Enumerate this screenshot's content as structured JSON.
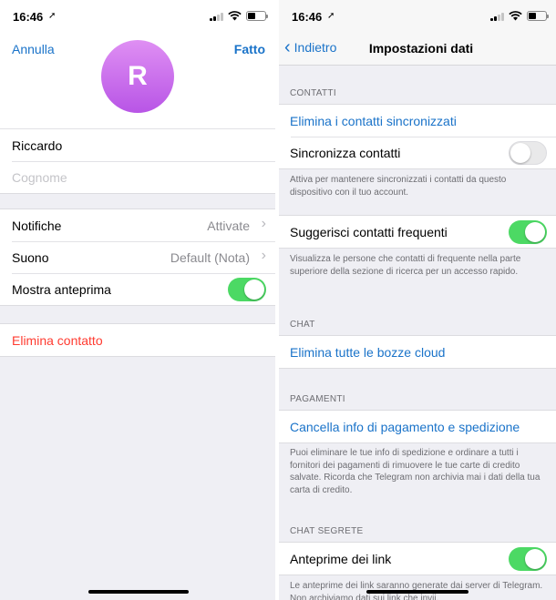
{
  "left": {
    "status": {
      "time": "16:46"
    },
    "nav": {
      "cancel": "Annulla",
      "done": "Fatto"
    },
    "avatar": {
      "initial": "R"
    },
    "name": {
      "first": "Riccardo",
      "last_placeholder": "Cognome"
    },
    "settings": [
      {
        "label": "Notifiche",
        "value": "Attivate"
      },
      {
        "label": "Suono",
        "value": "Default (Nota)"
      },
      {
        "label": "Mostra anteprima",
        "toggle": true
      }
    ],
    "delete": "Elimina contatto"
  },
  "right": {
    "status": {
      "time": "16:46"
    },
    "nav": {
      "back": "Indietro",
      "title": "Impostazioni dati"
    },
    "contacts": {
      "header": "CONTATTI",
      "delete_synced": "Elimina i contatti sincronizzati",
      "sync_label": "Sincronizza contatti",
      "sync_on": false,
      "sync_note": "Attiva per mantenere sincronizzati i contatti da questo dispositivo con il tuo account.",
      "suggest_label": "Suggerisci contatti frequenti",
      "suggest_on": true,
      "suggest_note": "Visualizza le persone che contatti di frequente nella parte superiore della sezione di ricerca per un accesso rapido."
    },
    "chat": {
      "header": "CHAT",
      "delete_drafts": "Elimina tutte le bozze cloud"
    },
    "payments": {
      "header": "PAGAMENTI",
      "clear_info": "Cancella info di pagamento e spedizione",
      "note": "Puoi eliminare le tue info di spedizione e ordinare a tutti i fornitori dei pagamenti di rimuovere le tue carte di credito salvate. Ricorda che Telegram non archivia mai i dati della tua carta di credito."
    },
    "secret": {
      "header": "CHAT SEGRETE",
      "link_preview_label": "Anteprime dei link",
      "link_preview_on": true,
      "note": "Le anteprime dei link saranno generate dai server di Telegram. Non archiviamo dati sui link che invii."
    }
  },
  "colors": {
    "accent": "#1a73c9",
    "destructive": "#ff3b30",
    "toggle_on": "#4cd964",
    "avatar_top": "#df8ff3",
    "avatar_bottom": "#b855e6"
  }
}
